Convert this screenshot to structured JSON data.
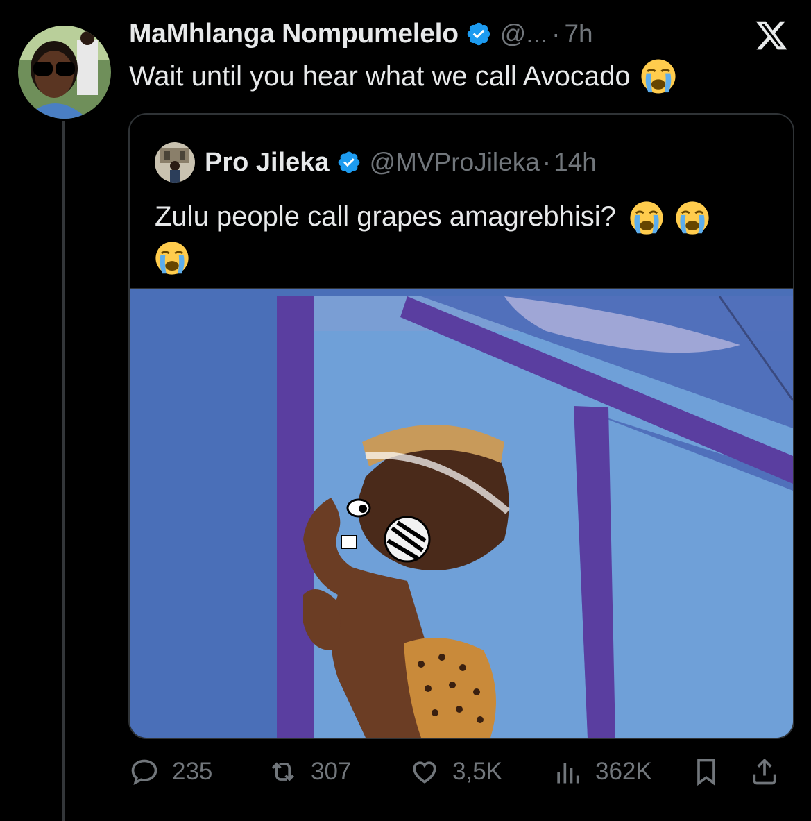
{
  "tweet": {
    "author": {
      "display_name": "MaMhlanga Nompumelelo",
      "handle": "@...",
      "time": "7h"
    },
    "text": "Wait until you hear what we call Avocado",
    "emoji": "loudly-crying-face"
  },
  "quote": {
    "author": {
      "display_name": "Pro Jileka",
      "handle": "@MVProJileka",
      "time": "14h"
    },
    "text": "Zulu people call grapes amagrebhisi?",
    "emoji": "loudly-crying-face",
    "emoji_count": 3
  },
  "actions": {
    "replies": "235",
    "retweets": "307",
    "likes": "3,5K",
    "views": "362K"
  },
  "icons": [
    "verified-badge-icon",
    "x-logo-icon",
    "reply-icon",
    "retweet-icon",
    "like-icon",
    "views-icon",
    "bookmark-icon",
    "share-icon"
  ],
  "colors": {
    "background": "#000000",
    "text": "#e7e9ea",
    "muted": "#71767b",
    "verified": "#1d9bf0",
    "border": "#2f3336"
  }
}
